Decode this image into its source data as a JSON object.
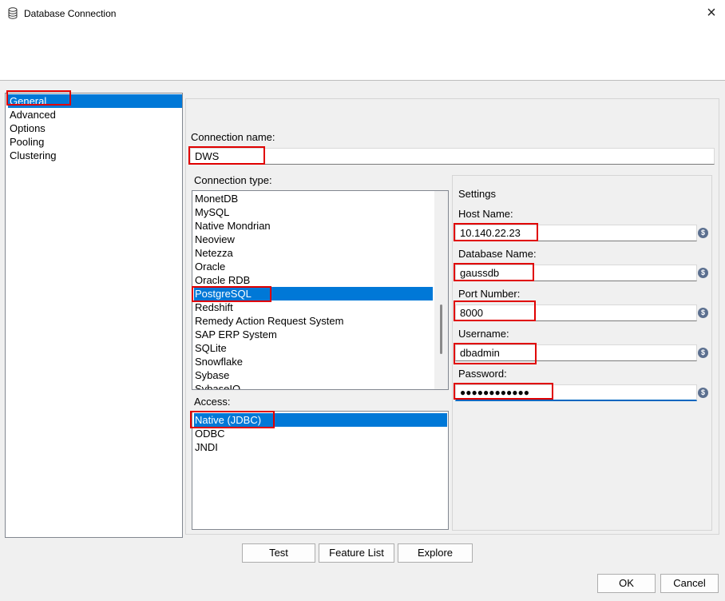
{
  "window": {
    "title": "Database Connection"
  },
  "nav": {
    "items": [
      "General",
      "Advanced",
      "Options",
      "Pooling",
      "Clustering"
    ],
    "selected": "General"
  },
  "connection": {
    "name_label": "Connection name:",
    "name_value": "DWS",
    "type_label": "Connection type:",
    "types": [
      "MonetDB",
      "MySQL",
      "Native Mondrian",
      "Neoview",
      "Netezza",
      "Oracle",
      "Oracle RDB",
      "PostgreSQL",
      "Redshift",
      "Remedy Action Request System",
      "SAP ERP System",
      "SQLite",
      "Snowflake",
      "Sybase",
      "SybaseIQ"
    ],
    "type_selected": "PostgreSQL",
    "access_label": "Access:",
    "access": [
      "Native (JDBC)",
      "ODBC",
      "JNDI"
    ],
    "access_selected": "Native (JDBC)"
  },
  "settings": {
    "title": "Settings",
    "host_label": "Host Name:",
    "host_value": "10.140.22.23",
    "db_label": "Database Name:",
    "db_value": "gaussdb",
    "port_label": "Port Number:",
    "port_value": "8000",
    "user_label": "Username:",
    "user_value": "dbadmin",
    "password_label": "Password:",
    "password_value": "●●●●●●●●●●●●",
    "variable_icon": "$"
  },
  "buttons": {
    "test": "Test",
    "feature_list": "Feature List",
    "explore": "Explore",
    "ok": "OK",
    "cancel": "Cancel"
  },
  "colors": {
    "selection": "#0078d7",
    "highlight_box": "#e00000",
    "focus_underline": "#0067c0"
  }
}
